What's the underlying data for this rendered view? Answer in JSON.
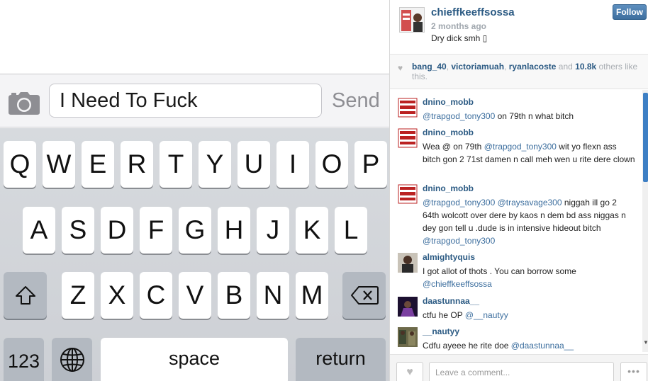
{
  "message": {
    "input_value": "I Need To Fuck",
    "send_label": "Send"
  },
  "keyboard": {
    "row1": [
      "Q",
      "W",
      "E",
      "R",
      "T",
      "Y",
      "U",
      "I",
      "O",
      "P"
    ],
    "row2": [
      "A",
      "S",
      "D",
      "F",
      "G",
      "H",
      "J",
      "K",
      "L"
    ],
    "row3": [
      "Z",
      "X",
      "C",
      "V",
      "B",
      "N",
      "M"
    ],
    "numbers_label": "123",
    "space_label": "space",
    "return_label": "return",
    "shift_icon": "shift-icon",
    "delete_icon": "backspace-icon",
    "globe_icon": "globe-icon"
  },
  "post": {
    "username": "chieffkeeffsossa",
    "time": "2 months ago",
    "caption": "Dry dick smh ▯",
    "follow_label": "Follow"
  },
  "likes": {
    "users": [
      "bang_40",
      "victoriamuah",
      "ryanlacoste"
    ],
    "separator": ", ",
    "and_text": " and ",
    "count": "10.8k",
    "suffix": " others like this."
  },
  "comments": [
    {
      "user": "dnino_mobb",
      "parts": [
        {
          "m": true,
          "t": "@trapgod_tony300"
        },
        {
          "m": false,
          "t": " on 79th n what bitch"
        }
      ]
    },
    {
      "user": "dnino_mobb",
      "parts": [
        {
          "m": false,
          "t": "Wea @ on 79th "
        },
        {
          "m": true,
          "t": "@trapgod_tony300"
        },
        {
          "m": false,
          "t": " wit yo flexn ass bitch gon 2 71st damen n call meh wen u rite dere clown"
        }
      ]
    },
    {
      "user": "dnino_mobb",
      "parts": [
        {
          "m": true,
          "t": "@trapgod_tony300"
        },
        {
          "m": false,
          "t": " "
        },
        {
          "m": true,
          "t": "@traysavage300"
        },
        {
          "m": false,
          "t": " niggah ill go 2 64th wolcott over dere by kaos n dem bd ass niggas n dey gon tell u .dude is in intensive hideout bitch "
        },
        {
          "m": true,
          "t": "@trapgod_tony300"
        }
      ]
    },
    {
      "user": "almightyquis",
      "parts": [
        {
          "m": false,
          "t": "I got allot of thots . You can borrow some "
        },
        {
          "m": true,
          "t": "@chieffkeeffsossa"
        }
      ]
    },
    {
      "user": "daastunnaa__",
      "parts": [
        {
          "m": false,
          "t": "ctfu he OP "
        },
        {
          "m": true,
          "t": "@__nautyy"
        }
      ]
    },
    {
      "user": "__nautyy",
      "parts": [
        {
          "m": false,
          "t": "Cdfu ayeee he rite doe "
        },
        {
          "m": true,
          "t": "@daastunnaa__"
        }
      ]
    }
  ],
  "comment_bar": {
    "placeholder": "Leave a comment...",
    "more_label": "•••"
  },
  "colors": {
    "link": "#2b5a83",
    "follow_button": "#4a7bab",
    "scroll_thumb": "#3d7fc4"
  }
}
